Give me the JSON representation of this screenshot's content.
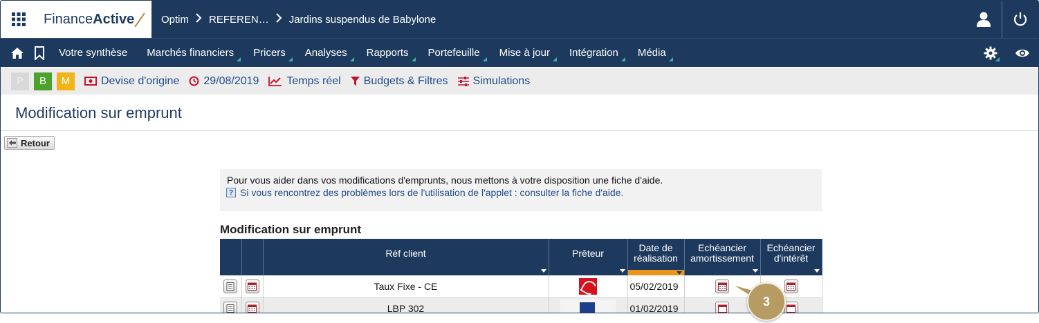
{
  "app": {
    "logo_light": "Finance",
    "logo_bold": "Active",
    "breadcrumb": [
      "Optim",
      "REFEREN…",
      "Jardins suspendus de Babylone"
    ]
  },
  "nav": {
    "items": [
      "Votre synthèse",
      "Marchés financiers",
      "Pricers",
      "Analyses",
      "Rapports",
      "Portefeuille",
      "Mise à jour",
      "Intégration",
      "Média"
    ],
    "icons": [
      "home-icon",
      "bookmark-icon",
      "gear-icon",
      "eye-icon"
    ]
  },
  "toolbar": {
    "pbm": [
      "P",
      "B",
      "M"
    ],
    "devise": "Devise d'origine",
    "date": "29/08/2019",
    "temps_reel": "Temps réel",
    "budgets": "Budgets & Filtres",
    "simulations": "Simulations"
  },
  "page": {
    "title": "Modification sur emprunt",
    "back_label": "Retour",
    "help_line1": "Pour vous aider dans vos modifications d'emprunts, nous mettons à votre disposition une fiche d'aide.",
    "help_line2": "Si vous rencontrez des problèmes lors de l'utilisation de l'applet : consulter la fiche d'aide.",
    "section_title": "Modification sur emprunt"
  },
  "table": {
    "headers": {
      "ref_client": "Réf client",
      "preteur": "Prêteur",
      "date_line1": "Date de",
      "date_line2": "réalisation",
      "amort_line1": "Echéancier",
      "amort_line2": "amortissement",
      "interet_line1": "Echéancier",
      "interet_line2": "d'intérêt"
    },
    "rows": [
      {
        "ref_client": "Taux Fixe - CE",
        "preteur_logo": "caisse-epargne-logo",
        "date": "05/02/2019"
      },
      {
        "ref_client": "LBP 302",
        "preteur_logo": "la-banque-postale-logo",
        "date": "01/02/2019"
      }
    ]
  },
  "annotation": {
    "step": "3"
  },
  "colors": {
    "navy": "#1d3a5e",
    "accent_teal": "#3cb4a8",
    "date_sort_orange": "#e8971c",
    "link_blue": "#1f4c8a",
    "badge_b": "#4ca32b",
    "badge_m": "#f2b418",
    "marker": "#b69b62"
  }
}
